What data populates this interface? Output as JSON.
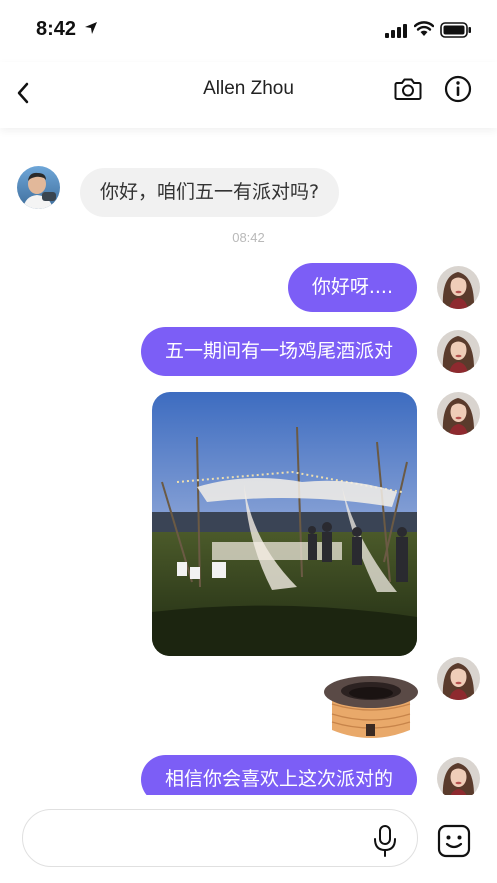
{
  "status_bar": {
    "time": "8:42"
  },
  "nav": {
    "title": "Allen Zhou",
    "back_icon": "chevron-left-icon",
    "camera_icon": "camera-icon",
    "info_icon": "info-icon"
  },
  "conversation": {
    "timestamp": "08:42",
    "messages": [
      {
        "sender": "Allen Zhou",
        "type": "text",
        "text": "你好，咱们五一有派对吗?"
      },
      {
        "sender": "me",
        "type": "text",
        "text": "你好呀...."
      },
      {
        "sender": "me",
        "type": "text",
        "text": "五一期间有一场鸡尾酒派对"
      },
      {
        "sender": "me",
        "type": "image"
      },
      {
        "sender": "me",
        "type": "sticker"
      },
      {
        "sender": "me",
        "type": "text",
        "text": "相信你会喜欢上这次派对的"
      }
    ]
  },
  "input": {
    "placeholder": "",
    "mic_icon": "microphone-icon",
    "emoji_icon": "emoji-icon"
  },
  "colors": {
    "accent": "#7c5ef6",
    "incoming_bubble": "#f1f1f1",
    "timestamp": "#b9b9b9"
  }
}
